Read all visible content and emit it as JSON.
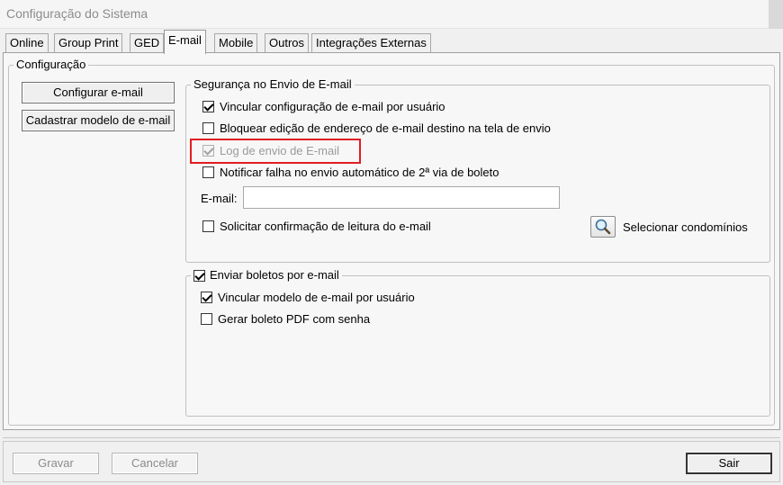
{
  "window": {
    "title": "Configuração do Sistema"
  },
  "tabs": [
    {
      "label": "Online"
    },
    {
      "label": "Group Print"
    },
    {
      "label": "GED"
    },
    {
      "label": "E-mail",
      "active": true
    },
    {
      "label": "Mobile"
    },
    {
      "label": "Outros"
    },
    {
      "label": "Integrações Externas"
    }
  ],
  "config_group": {
    "legend": "Configuração"
  },
  "left_buttons": {
    "configure_email": "Configurar e-mail",
    "register_template": "Cadastrar modelo de e-mail"
  },
  "security_group": {
    "legend": "Segurança no Envio de E-mail",
    "options": [
      {
        "label": "Vincular configuração de e-mail por usuário",
        "checked": true,
        "enabled": true
      },
      {
        "label": "Bloquear edição de endereço de e-mail destino na tela de envio",
        "checked": false,
        "enabled": true
      },
      {
        "label": "Log de envio de E-mail",
        "checked": true,
        "enabled": false
      },
      {
        "label": "Notificar falha no envio automático de 2ª via de boleto",
        "checked": false,
        "enabled": true
      }
    ],
    "email_field": {
      "label": "E-mail:",
      "value": ""
    },
    "read_confirmation": {
      "label": "Solicitar confirmação de leitura do e-mail",
      "checked": false
    },
    "select_condos": {
      "label": "Selecionar condomínios",
      "icon": "magnifier-icon"
    }
  },
  "boletos_group": {
    "legend": "Enviar boletos por e-mail",
    "legend_checked": true,
    "options": [
      {
        "label": "Vincular modelo de e-mail por usuário",
        "checked": true
      },
      {
        "label": "Gerar boleto PDF com senha",
        "checked": false
      }
    ]
  },
  "footer": {
    "save": "Gravar",
    "cancel": "Cancelar",
    "exit": "Sair"
  },
  "colors": {
    "highlight": "#e11d22",
    "disabled_text": "#9a9a9a"
  }
}
